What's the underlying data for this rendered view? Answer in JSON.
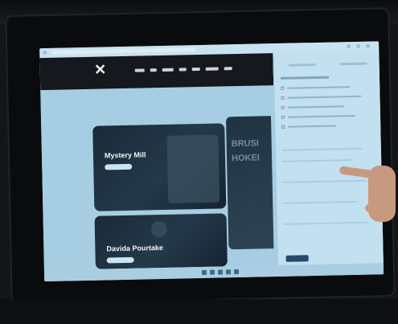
{
  "site": {
    "card1_title": "Mystery Mill",
    "card2_title": "Davida Pourtake",
    "side_card_line1": "BRUSI",
    "side_card_line2": "HOKEI"
  },
  "icons": [
    "site-logo-icon",
    "hand-pointer"
  ],
  "colors": {
    "screen_bg": "#b4d6ea",
    "site_header": "#15181c",
    "card_bg": "#1f3343",
    "panel_bg": "#c3e0f0"
  }
}
